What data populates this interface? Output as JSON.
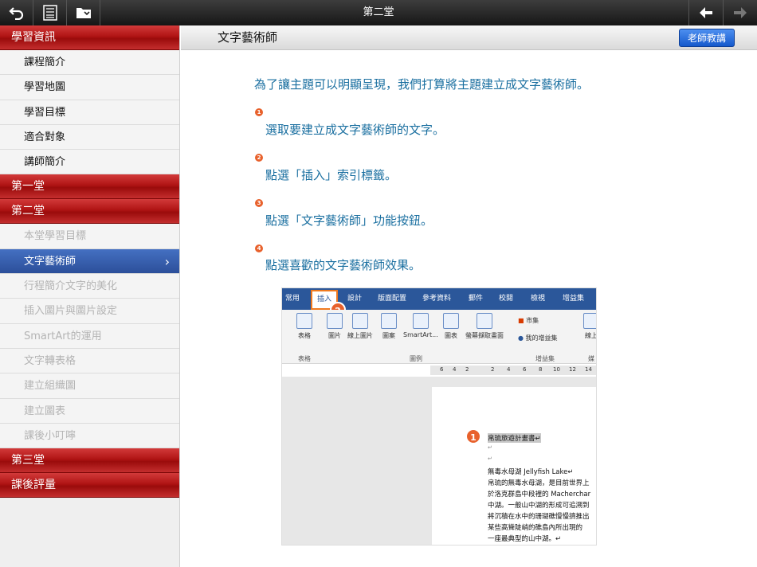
{
  "topbar": {
    "title": "第二堂"
  },
  "sidebar": {
    "sections": [
      {
        "label": "學習資訊",
        "items": [
          {
            "label": "課程簡介",
            "state": "normal"
          },
          {
            "label": "學習地圖",
            "state": "normal"
          },
          {
            "label": "學習目標",
            "state": "normal"
          },
          {
            "label": "適合對象",
            "state": "normal"
          },
          {
            "label": "講師簡介",
            "state": "normal"
          }
        ]
      },
      {
        "label": "第一堂",
        "items": []
      },
      {
        "label": "第二堂",
        "items": [
          {
            "label": "本堂學習目標",
            "state": "dim"
          },
          {
            "label": "文字藝術師",
            "state": "active"
          },
          {
            "label": "行程簡介文字的美化",
            "state": "dim"
          },
          {
            "label": "插入圖片與圖片設定",
            "state": "dim"
          },
          {
            "label": "SmartArt的運用",
            "state": "dim"
          },
          {
            "label": "文字轉表格",
            "state": "dim"
          },
          {
            "label": "建立組織圖",
            "state": "dim"
          },
          {
            "label": "建立圖表",
            "state": "dim"
          },
          {
            "label": "課後小叮嚀",
            "state": "dim"
          }
        ]
      },
      {
        "label": "第三堂",
        "items": []
      },
      {
        "label": "課後評量",
        "items": []
      }
    ]
  },
  "header": {
    "title": "文字藝術師",
    "teacher_button": "老師教講"
  },
  "content": {
    "intro": "為了讓主題可以明顯呈現，我們打算將主題建立成文字藝術師。",
    "steps": [
      {
        "num": "1",
        "text": "選取要建立成文字藝術師的文字。"
      },
      {
        "num": "2",
        "text": "點選「插入」索引標籤。"
      },
      {
        "num": "3",
        "text": "點選「文字藝術師」功能按鈕。"
      },
      {
        "num": "4",
        "text": "點選喜歡的文字藝術師效果。"
      }
    ]
  },
  "screenshot": {
    "tabs": [
      "常用",
      "插入",
      "設計",
      "版面配置",
      "參考資料",
      "郵件",
      "校閱",
      "檢視",
      "增益集"
    ],
    "buttons": [
      "表格",
      "圖片",
      "線上圖片",
      "圖案",
      "SmartArt...",
      "圖表",
      "螢幕擷取畫面",
      "市集",
      "我的增益集",
      "線上"
    ],
    "groups": [
      "表格",
      "圖例",
      "增益集",
      "媒"
    ],
    "ruler": [
      "6",
      "4",
      "2",
      "2",
      "4",
      "6",
      "8",
      "10",
      "12",
      "14"
    ],
    "badge1": "1",
    "badge2": "2",
    "doc_lines": [
      "帛琉旅遊計畫書↵",
      "↵",
      "↵",
      "無毒水母湖 Jellyfish Lake↵",
      "帛琉的無毒水母湖，是目前世界上",
      "於洛克群島中段裡的 Macherchar",
      "中湖。一般山中湖的形成可追溯到",
      "將沉積在水中的珊瑚礁慢慢擠推出",
      "某些高聳陡峭的礁島內所出現的",
      "一座最典型的山中湖。↵"
    ]
  },
  "colors": {
    "accent_red": "#b01414",
    "active_blue": "#3560b0",
    "text_blue": "#1a6fa0",
    "step_orange": "#e8612c"
  }
}
